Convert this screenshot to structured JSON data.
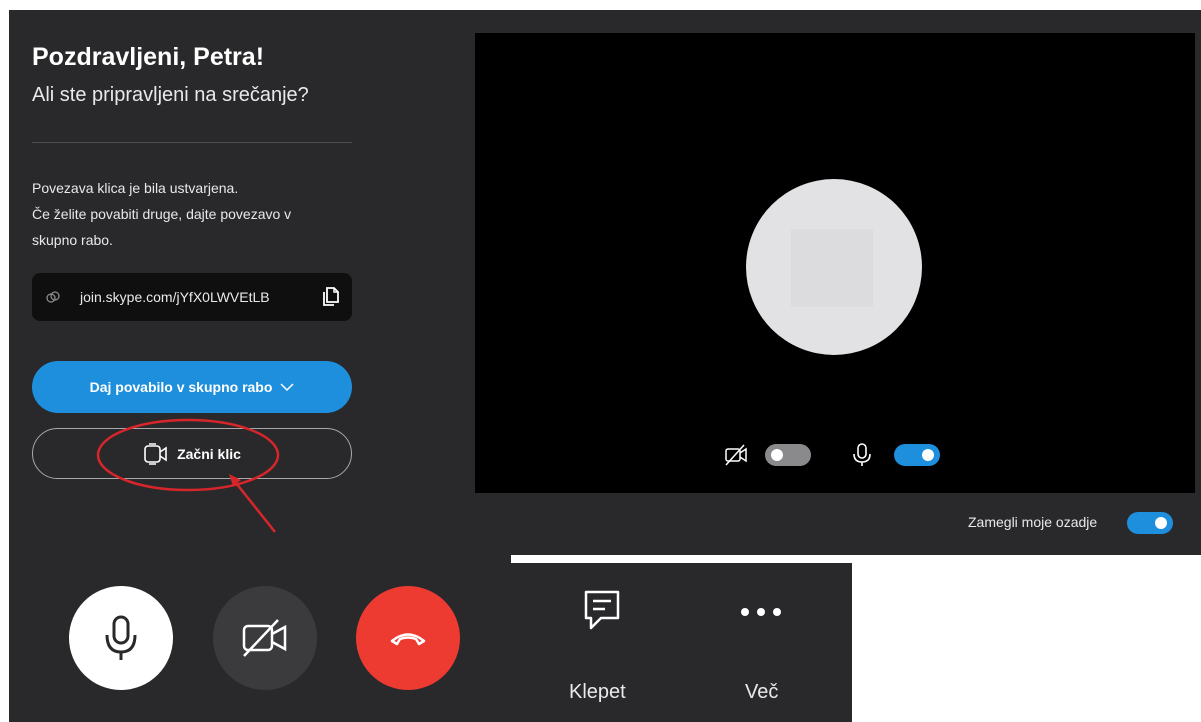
{
  "greeting": {
    "title": "Pozdravljeni, Petra!",
    "subtitle": "Ali ste pripravljeni na srečanje?"
  },
  "info": {
    "line1": "Povezava klica je bila ustvarjena.",
    "line2": "Če želite povabiti druge, dajte povezavo v",
    "line3": "skupno rabo."
  },
  "link": {
    "url": "join.skype.com/jYfX0LWVEtLB",
    "icon": "link-icon",
    "copy_icon": "copy-icon"
  },
  "buttons": {
    "share_label": "Daj povabilo v skupno rabo",
    "start_label": "Začni klic"
  },
  "preview": {
    "camera_toggle_on": false,
    "mic_toggle_on": true,
    "blur_label": "Zamegli moje ozadje",
    "blur_toggle_on": true
  },
  "call_controls": {
    "chat_label": "Klepet",
    "more_label": "Več"
  },
  "colors": {
    "panel": "#29292b",
    "accent": "#1e8fdc",
    "hangup": "#ee3b32",
    "annotation": "#d7262b"
  }
}
